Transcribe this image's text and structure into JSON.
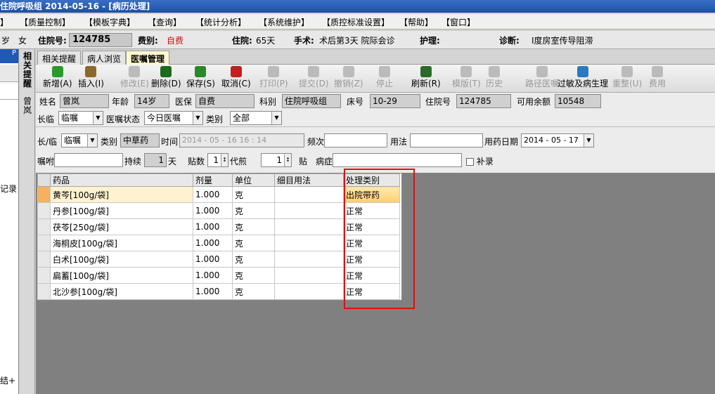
{
  "title": "住院呼吸组  2014-05-16 - [病历处理]",
  "menu": [
    "】",
    "【质量控制】",
    "【模板字典】",
    "【查询】",
    "【统计分析】",
    "【系统维护】",
    "【质控标准设置】",
    "【帮助】",
    "【窗口】"
  ],
  "patient": {
    "age_suffix": "岁",
    "gender": "女",
    "inpatient_no_label": "住院号:",
    "inpatient_no": "124785",
    "fee_label": "费别:",
    "fee": "自费",
    "stay_label": "住院:",
    "stay": "65天",
    "surgery_label": "手术:",
    "surgery": "术后第3天 院际会诊",
    "nursing_label": "护理:",
    "diagnosis_label": "诊断:",
    "diagnosis": "I度房室传导阻滞"
  },
  "left_panel": {
    "pin": "P",
    "side_text_1": "记录",
    "side_text_2": "结+"
  },
  "vtabs": [
    "相关提醒",
    "曾岚"
  ],
  "tabs": [
    "相关提醒",
    "病人浏览",
    "医嘱管理"
  ],
  "toolbar": [
    {
      "label": "新增(A)",
      "icon": "add-icon",
      "color": "#2a9a2a",
      "enabled": true
    },
    {
      "label": "插入(I)",
      "icon": "insert-icon",
      "color": "#8a6a2a",
      "enabled": true
    },
    {
      "label": "修改(E)",
      "icon": "edit-icon",
      "color": "#bbb",
      "enabled": false
    },
    {
      "label": "删除(D)",
      "icon": "delete-icon",
      "color": "#1c6a1c",
      "enabled": true
    },
    {
      "label": "保存(S)",
      "icon": "save-icon",
      "color": "#2a8a2a",
      "enabled": true
    },
    {
      "label": "取消(C)",
      "icon": "undo-icon",
      "color": "#c02020",
      "enabled": true
    },
    {
      "label": "打印(P)",
      "icon": "print-icon",
      "color": "#bbb",
      "enabled": false
    },
    {
      "label": "提交(D)",
      "icon": "submit-icon",
      "color": "#bbb",
      "enabled": false
    },
    {
      "label": "撤销(Z)",
      "icon": "trash-icon",
      "color": "#bbb",
      "enabled": false
    },
    {
      "label": "停止",
      "icon": "stop-icon",
      "color": "#bbb",
      "enabled": false
    },
    {
      "label": "刷新(R)",
      "icon": "refresh-icon",
      "color": "#2a6a2a",
      "enabled": true
    },
    {
      "label": "模版(T)",
      "icon": "template-icon",
      "color": "#bbb",
      "enabled": false
    },
    {
      "label": "历史",
      "icon": "history-icon",
      "color": "#bbb",
      "enabled": false
    },
    {
      "label": "路径医嘱",
      "icon": "path-icon",
      "color": "#bbb",
      "enabled": false
    },
    {
      "label": "过敏及病生理",
      "icon": "allergy-icon",
      "color": "#2a7ac0",
      "enabled": true
    },
    {
      "label": "重整(U)",
      "icon": "reorganize-icon",
      "color": "#bbb",
      "enabled": false
    },
    {
      "label": "费用",
      "icon": "fee-icon",
      "color": "#bbb",
      "enabled": false
    }
  ],
  "form": {
    "name_label": "姓名",
    "name": "曾岚",
    "age_label": "年龄",
    "age": "14岁",
    "insurance_label": "医保",
    "insurance": "自费",
    "dept_label": "科别",
    "dept": "住院呼吸组",
    "bed_label": "床号",
    "bed": "10-29",
    "inpatient_label": "住院号",
    "inpatient": "124785",
    "balance_label": "可用余额",
    "balance": "10548",
    "longtemp_label": "长临",
    "longtemp": "临嘱",
    "status_label": "医嘱状态",
    "status": "今日医嘱",
    "category_label": "类别",
    "category": "全部"
  },
  "entry": {
    "longtemp_label": "长/临",
    "longtemp": "临嘱",
    "category_label": "类别",
    "category": "中草药",
    "time_label": "时间",
    "time": "2014 - 05 - 16   16 : 14",
    "freq_label": "频次",
    "freq": "",
    "usage_label": "用法",
    "usage": "",
    "date_label": "用药日期",
    "date": "2014 - 05 - 17",
    "instruction_label": "嘱咐",
    "instruction": "",
    "duration_label": "持续",
    "duration": "1",
    "duration_unit": "天",
    "doses_label": "贴数",
    "doses": "1",
    "decoct_label": "代煎",
    "decoct": "1",
    "tie_label": "贴",
    "disease_label": "病症",
    "disease": "",
    "supplement_label": "补录"
  },
  "grid": {
    "headers": [
      "药品",
      "剂量",
      "单位",
      "细目用法",
      "处理类别"
    ],
    "rows": [
      [
        "黄芩[100g/袋]",
        "1.000",
        "克",
        "",
        "出院带药"
      ],
      [
        "丹参[100g/袋]",
        "1.000",
        "克",
        "",
        "正常"
      ],
      [
        "茯苓[250g/袋]",
        "1.000",
        "克",
        "",
        "正常"
      ],
      [
        "海桐皮[100g/袋]",
        "1.000",
        "克",
        "",
        "正常"
      ],
      [
        "白术[100g/袋]",
        "1.000",
        "克",
        "",
        "正常"
      ],
      [
        "扁蓄[100g/袋]",
        "1.000",
        "克",
        "",
        "正常"
      ],
      [
        "北沙参[100g/袋]",
        "1.000",
        "克",
        "",
        "正常"
      ]
    ]
  }
}
